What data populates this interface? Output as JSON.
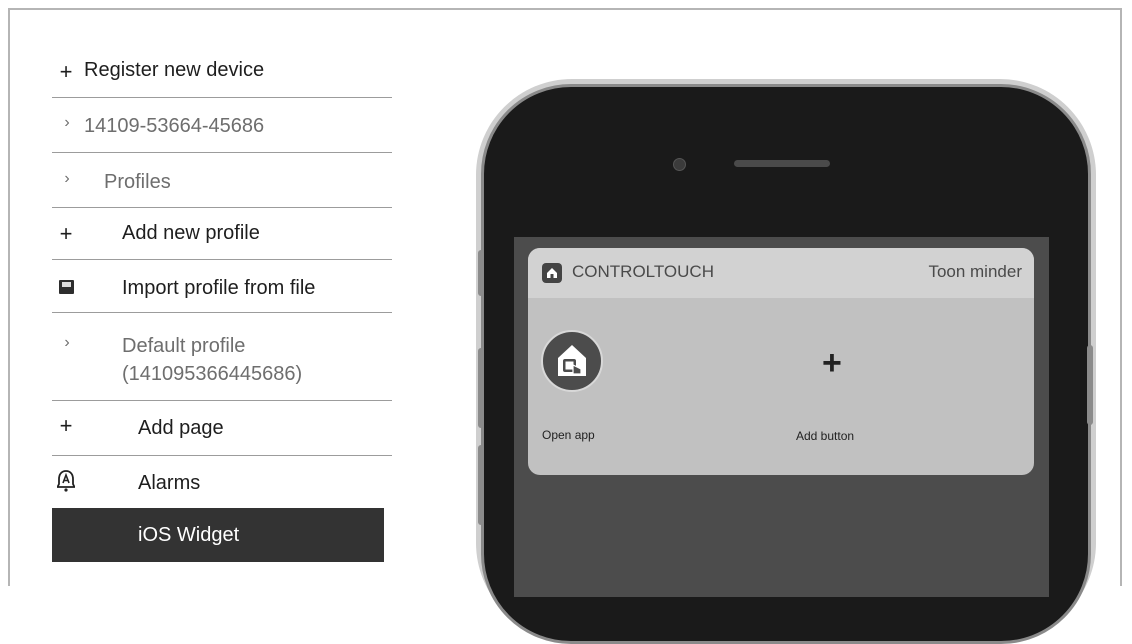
{
  "sidebar": {
    "items": [
      {
        "icon": "plus-icon",
        "label": "Register new device"
      },
      {
        "icon": "chevron-right-icon",
        "label": "14109-53664-45686"
      },
      {
        "icon": "chevron-right-icon",
        "label": "Profiles"
      },
      {
        "icon": "plus-icon",
        "label": "Add new profile"
      },
      {
        "icon": "floppy-disk-icon",
        "label": "Import profile from file"
      },
      {
        "icon": "chevron-right-icon",
        "label": "Default profile (141095366445686)"
      },
      {
        "icon": "plus-icon",
        "label": "Add page"
      },
      {
        "icon": "alarm-icon",
        "label": "Alarms"
      },
      {
        "icon": "",
        "label": "iOS Widget",
        "selected": true
      }
    ],
    "glyphs": {
      "plus": "+",
      "chevron": "›"
    }
  },
  "widget": {
    "app_name": "CONTROLTOUCH",
    "action": "Toon minder",
    "open_app_label": "Open app",
    "add_button_label": "Add button",
    "add_glyph": "+"
  },
  "colors": {
    "selected_bg": "#333333",
    "widget_bg": "#c1c1c1",
    "widget_header_bg": "#d2d2d2"
  }
}
